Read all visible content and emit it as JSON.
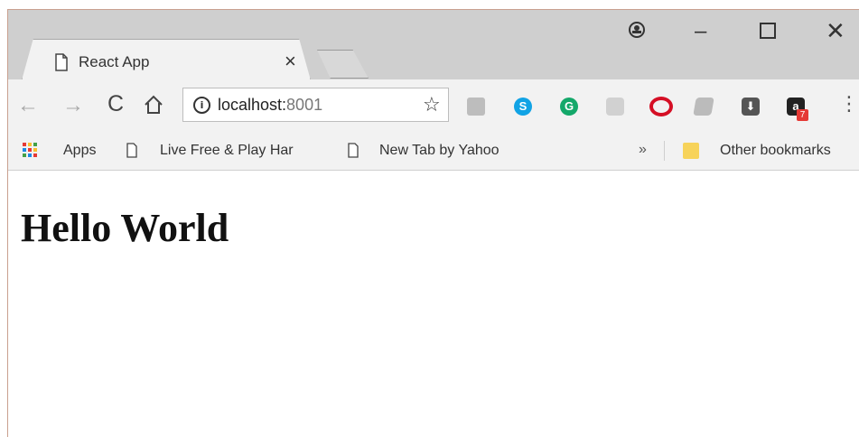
{
  "tab": {
    "title": "React App",
    "close_label": "×",
    "page_icon": "page-icon"
  },
  "window_controls": {
    "minimize_label": "–",
    "close_label": "✕",
    "profile_icon": "user-icon"
  },
  "toolbar": {
    "back_label": "←",
    "forward_label": "→",
    "reload_label": "C",
    "url_host": "localhost:",
    "url_port": "8001",
    "star_label": "☆",
    "menu_label": "⋮",
    "extensions": [
      "google-drive-icon",
      "skype-icon",
      "grammarly-icon",
      "acrobat-icon",
      "opera-icon",
      "box-icon",
      "download-icon",
      "amazon-icon"
    ],
    "skype_letter": "S",
    "grammarly_letter": "G",
    "amazon_letter": "a",
    "amazon_badge": "7"
  },
  "bookmarks": {
    "apps_label": "Apps",
    "items": [
      {
        "label": "Live Free & Play Har"
      },
      {
        "label": "New Tab by Yahoo"
      }
    ],
    "overflow_label": "»",
    "other_label": "Other bookmarks"
  },
  "page": {
    "heading": "Hello World"
  },
  "colors": {
    "tabstrip": "#cfcfcf",
    "toolbar": "#f2f2f2",
    "window_border": "#c9a08f"
  }
}
